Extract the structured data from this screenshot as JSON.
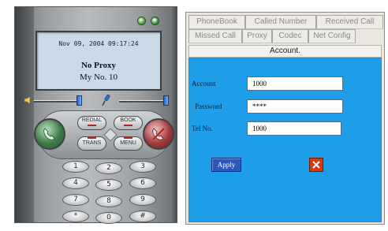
{
  "phone": {
    "display": {
      "datetime": "Nov 09, 2004 09:17:24",
      "proxy_status": "No Proxy",
      "my_number": "My No. 10"
    },
    "function_keys": {
      "redial": "REDIAL",
      "book": "BOOK",
      "trans": "TRANS",
      "menu": "MENU"
    },
    "keypad": [
      "1",
      "2",
      "3",
      "4",
      "5",
      "6",
      "7",
      "8",
      "9",
      "*",
      "0",
      "#"
    ],
    "colors": {
      "call_green": "#3d7a46",
      "hangup_red": "#a13a3a",
      "slider_blue": "#1e62c6"
    }
  },
  "config": {
    "tabs_row1": [
      "PhoneBook",
      "Called Number",
      "Received Call"
    ],
    "tabs_row2": [
      "Missed Call",
      "Proxy",
      "Codec",
      "Net Config"
    ],
    "active_tab": "Account.",
    "form": {
      "account_label": "Account",
      "account_value": "1000",
      "password_label": "Password",
      "password_value": "****",
      "tel_label": "Tel No.",
      "tel_value": "1000",
      "apply_label": "Apply"
    },
    "colors": {
      "form_background": "#1e9ee8",
      "apply_button": "#2e57b8",
      "cancel_button": "#d63a14"
    }
  }
}
